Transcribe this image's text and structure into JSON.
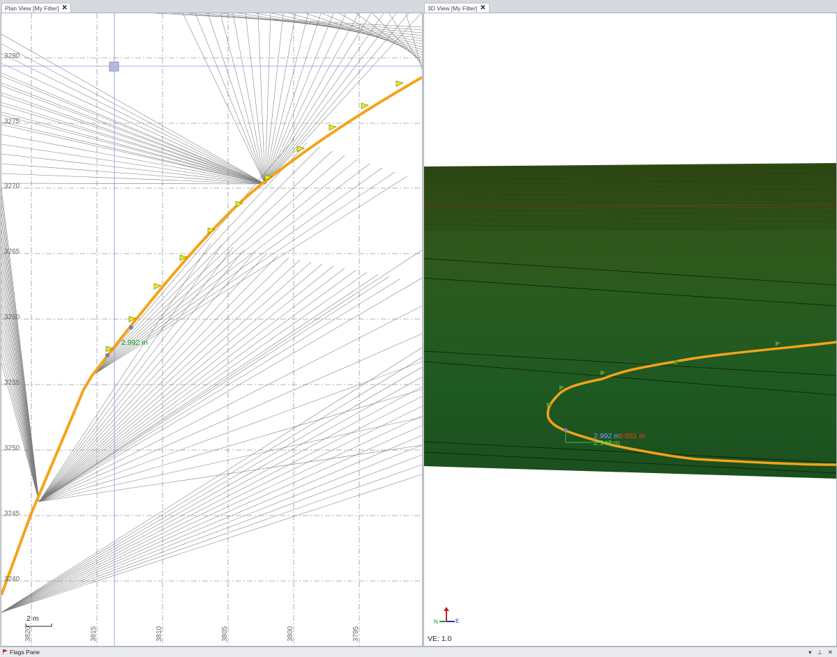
{
  "tabs": {
    "plan": {
      "label": "Plan View [My Filter]",
      "close": "✕"
    },
    "view3d": {
      "label": "3D View [My Filter]",
      "close": "✕"
    }
  },
  "plan": {
    "y_ticks": [
      "3280",
      "3275",
      "3270",
      "3265",
      "3260",
      "3255",
      "3250",
      "3245",
      "3240"
    ],
    "x_ticks": [
      "3820",
      "3815",
      "3810",
      "3805",
      "3800",
      "3795"
    ],
    "scale_label": "2 m",
    "measure_label": "2.992 m"
  },
  "view3d": {
    "measure_blue": "2.992 m",
    "measure_red": "0.051 m",
    "measure_green": "2.942 m",
    "axis_n": "N",
    "axis_e": "E",
    "ve_label": "VE: 1.0"
  },
  "flags_pane": {
    "label": "Flags Pane",
    "controls": [
      "▾",
      "⊥",
      "✕"
    ]
  },
  "colors": {
    "curve": "#f5a31a",
    "terrain": "#2a5a1c",
    "grid": "#8a8a8a",
    "flag": "#e8e820"
  }
}
